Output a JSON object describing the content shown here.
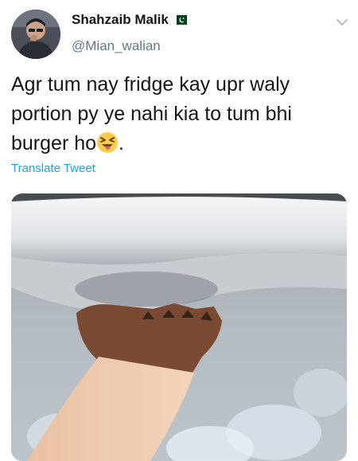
{
  "tweet": {
    "author": {
      "display_name": "Shahzaib Malik",
      "handle": "@Mian_walian",
      "avatar": "profile-photo",
      "flag": "pakistan-flag-icon"
    },
    "text": "Agr tum nay fridge kay upr waly portion py ye nahi kia to tum bhi burger ho",
    "text_end": ".",
    "emoji": "squinting-face-with-tongue-icon",
    "translate_label": "Translate Tweet",
    "menu_icon": "chevron-down-icon",
    "media": "photo-hand-in-freezer-frost"
  },
  "colors": {
    "text": "#14171a",
    "secondary": "#657786",
    "link": "#1da1f2",
    "flag_green": "#01411c"
  }
}
